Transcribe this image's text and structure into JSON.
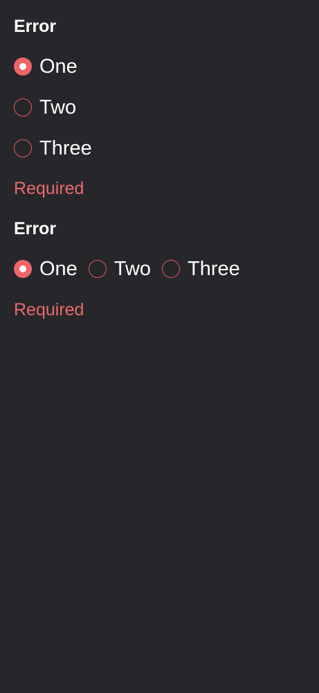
{
  "colors": {
    "background": "#27272b",
    "text": "#ffffff",
    "error_accent": "#ef6468",
    "helper_text": "#ea6a6c"
  },
  "groups": [
    {
      "layout": "vertical",
      "label": "Error",
      "options": [
        {
          "label": "One",
          "checked": true
        },
        {
          "label": "Two",
          "checked": false
        },
        {
          "label": "Three",
          "checked": false
        }
      ],
      "helper": "Required"
    },
    {
      "layout": "horizontal",
      "label": "Error",
      "options": [
        {
          "label": "One",
          "checked": true
        },
        {
          "label": "Two",
          "checked": false
        },
        {
          "label": "Three",
          "checked": false
        }
      ],
      "helper": "Required"
    }
  ]
}
